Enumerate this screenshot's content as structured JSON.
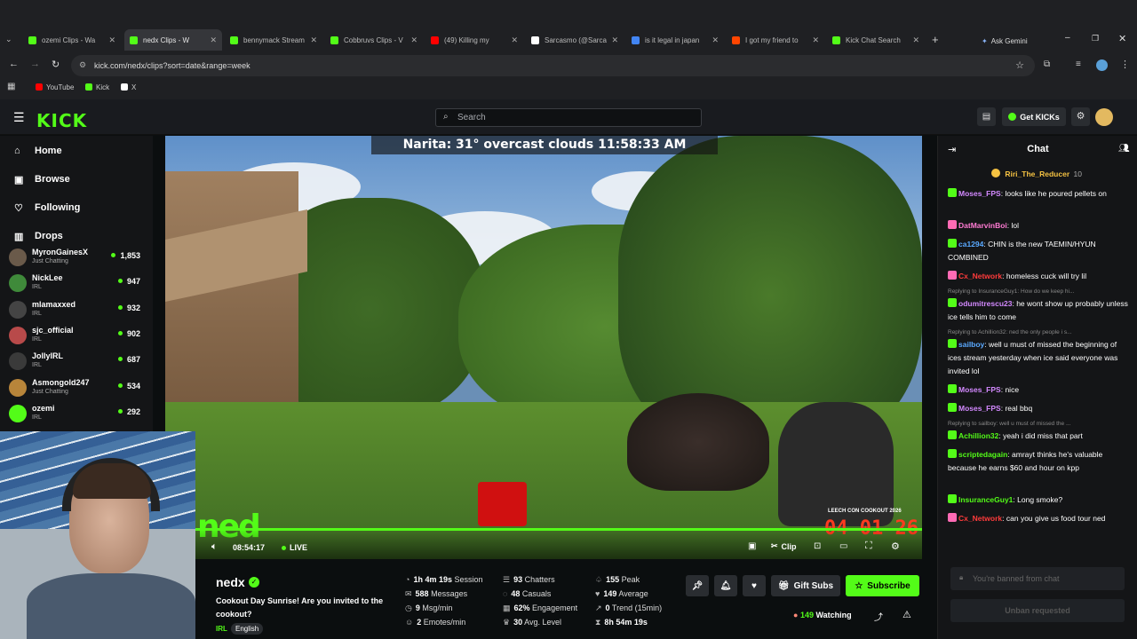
{
  "browser": {
    "tabs": [
      {
        "label": "ozemi Clips - Wa",
        "fav": "#53fc18"
      },
      {
        "label": "nedx Clips - W",
        "fav": "#53fc18",
        "active": true
      },
      {
        "label": "bennymack Stream",
        "fav": "#53fc18"
      },
      {
        "label": "Cobbruvs Clips - V",
        "fav": "#53fc18"
      },
      {
        "label": "(49) Killing my",
        "fav": "#ff0000"
      },
      {
        "label": "Sarcasmo (@Sarca",
        "fav": "#ffffff"
      },
      {
        "label": "is it legal in japan",
        "fav": "#4285f4"
      },
      {
        "label": "I got my friend to",
        "fav": "#ff4500"
      },
      {
        "label": "Kick Chat Search",
        "fav": "#53fc18"
      }
    ],
    "ask_gemini": "Ask Gemini",
    "url": "kick.com/nedx/clips?sort=date&range=week",
    "bookmarks": [
      {
        "label": "YouTube",
        "color": "#ff0000"
      },
      {
        "label": "Kick",
        "color": "#53fc18"
      },
      {
        "label": "X",
        "color": "#ffffff"
      }
    ]
  },
  "kick": {
    "logo": "KICK",
    "search_placeholder": "Search",
    "get_kicks": "Get KICKs",
    "nav": [
      {
        "label": "Home",
        "icon": "home-icon"
      },
      {
        "label": "Browse",
        "icon": "browse-icon"
      },
      {
        "label": "Following",
        "icon": "heart-icon"
      },
      {
        "label": "Drops",
        "icon": "drops-icon"
      }
    ],
    "channels": [
      {
        "name": "MyronGainesX",
        "category": "Just Chatting",
        "viewers": "1,853",
        "color": "#6a5a4a"
      },
      {
        "name": "NickLee",
        "category": "IRL",
        "viewers": "947",
        "color": "#3f8a3a"
      },
      {
        "name": "mlamaxxed",
        "category": "IRL",
        "viewers": "932",
        "color": "#444"
      },
      {
        "name": "sjc_official",
        "category": "IRL",
        "viewers": "902",
        "color": "#b84a4a"
      },
      {
        "name": "JollyIRL",
        "category": "IRL",
        "viewers": "687",
        "color": "#3a3a3a"
      },
      {
        "name": "Asmongold247",
        "category": "Just Chatting",
        "viewers": "534",
        "color": "#b8853a"
      },
      {
        "name": "ozemi",
        "category": "IRL",
        "viewers": "292",
        "color": "#53fc18"
      }
    ]
  },
  "video": {
    "overlay": "Narita: 31°      overcast clouds 11:58:33 AM",
    "time": "08:54:17",
    "live": "LIVE",
    "clip": "Clip",
    "event": "LEECH CON COOKOUT 2026",
    "event_date": "04 01 26",
    "logo_text": "ned"
  },
  "stream": {
    "channel": "nedx",
    "title": "Cookout Day Sunrise! Are you invited to the cookout?",
    "category": "IRL",
    "language": "English",
    "stats": [
      {
        "value": "1h 4m 19s",
        "label": "Session"
      },
      {
        "value": "588",
        "label": "Messages"
      },
      {
        "value": "9",
        "label": "Msg/min"
      },
      {
        "value": "2",
        "label": "Emotes/min"
      },
      {
        "value": "93",
        "label": "Chatters"
      },
      {
        "value": "48",
        "label": "Casuals"
      },
      {
        "value": "62%",
        "label": "Engagement"
      },
      {
        "value": "30",
        "label": "Avg. Level"
      },
      {
        "value": "155",
        "label": "Peak"
      },
      {
        "value": "149",
        "label": "Average"
      },
      {
        "value": "0",
        "label": "Trend (15min)"
      },
      {
        "value": "8h 54m 19s",
        "label": ""
      }
    ],
    "gift_subs": "Gift Subs",
    "subscribe": "Subscribe",
    "watching": "149",
    "watching_label": "Watching"
  },
  "chat": {
    "title": "Chat",
    "pinned_user": "Riri_The_Reducer",
    "pinned_count": "10",
    "messages": [
      {
        "user": "Moses_FPS",
        "color": "#d389ff",
        "text": "looks like he poured pellets on",
        "badge": "41"
      },
      {
        "user": "DatMarvinBoi",
        "color": "#ff7bd3",
        "text": "lol",
        "badge": ""
      },
      {
        "user": "ca1294",
        "color": "#5aa9ff",
        "text": "CHIN is the new TAEMIN/HYUN COMBINED",
        "badge": "38"
      },
      {
        "user": "Cx_Network",
        "color": "#ff3b3b",
        "text": "homeless cuck will try lil",
        "badge": ""
      },
      {
        "user": "odumitrescu23",
        "color": "#d389ff",
        "text": "he wont show up probably unless ice tells him to come",
        "badge": "10",
        "reply": "Replying to InsuranceGuy1: How do we keep hi..."
      },
      {
        "user": "sailboy",
        "color": "#5aa9ff",
        "text": "well u must of missed the beginning of ices stream yesterday when ice said everyone was invited lol",
        "badge": "38",
        "reply": "Replying to Achillion32: ned the only people i s..."
      },
      {
        "user": "Moses_FPS",
        "color": "#d389ff",
        "text": "nice",
        "badge": "41"
      },
      {
        "user": "Moses_FPS",
        "color": "#d389ff",
        "text": "real bbq",
        "badge": "41"
      },
      {
        "user": "Achillion32",
        "color": "#53fc18",
        "text": "yeah i did miss that part",
        "badge": "44",
        "reply": "Replying to sailboy: well u must of missed the ..."
      },
      {
        "user": "scriptedagain",
        "color": "#53fc18",
        "text": "amrayt thinks he's valuable because he earns $60 and hour on kpp",
        "badge": "38"
      },
      {
        "user": "InsuranceGuy1",
        "color": "#53fc18",
        "text": "Long smoke?",
        "badge": "44"
      },
      {
        "user": "Cx_Network",
        "color": "#ff3b3b",
        "text": "can you give us food tour ned",
        "badge": ""
      }
    ],
    "input_placeholder": "You're banned from chat",
    "unban": "Unban requested"
  }
}
